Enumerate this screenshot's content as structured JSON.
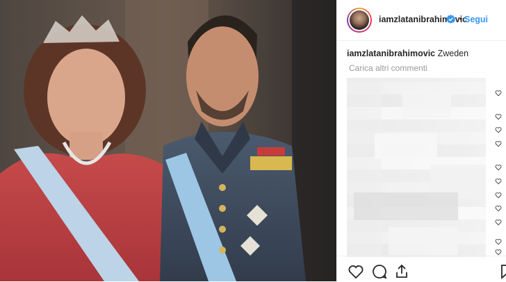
{
  "post": {
    "username": "iamzlatanibrahimovic",
    "follow_separator": "•",
    "follow_label": "Segui",
    "caption_user": "iamzlatanibrahimovic",
    "caption_text": "Zweden",
    "load_more_label": "Carica altri commenti"
  },
  "icons": {
    "verified": "verified-badge-icon",
    "like": "heart-icon",
    "comment": "comment-icon",
    "share": "share-icon",
    "save": "bookmark-icon"
  },
  "colors": {
    "link": "#3897f0",
    "text": "#262626",
    "muted": "#999999"
  }
}
